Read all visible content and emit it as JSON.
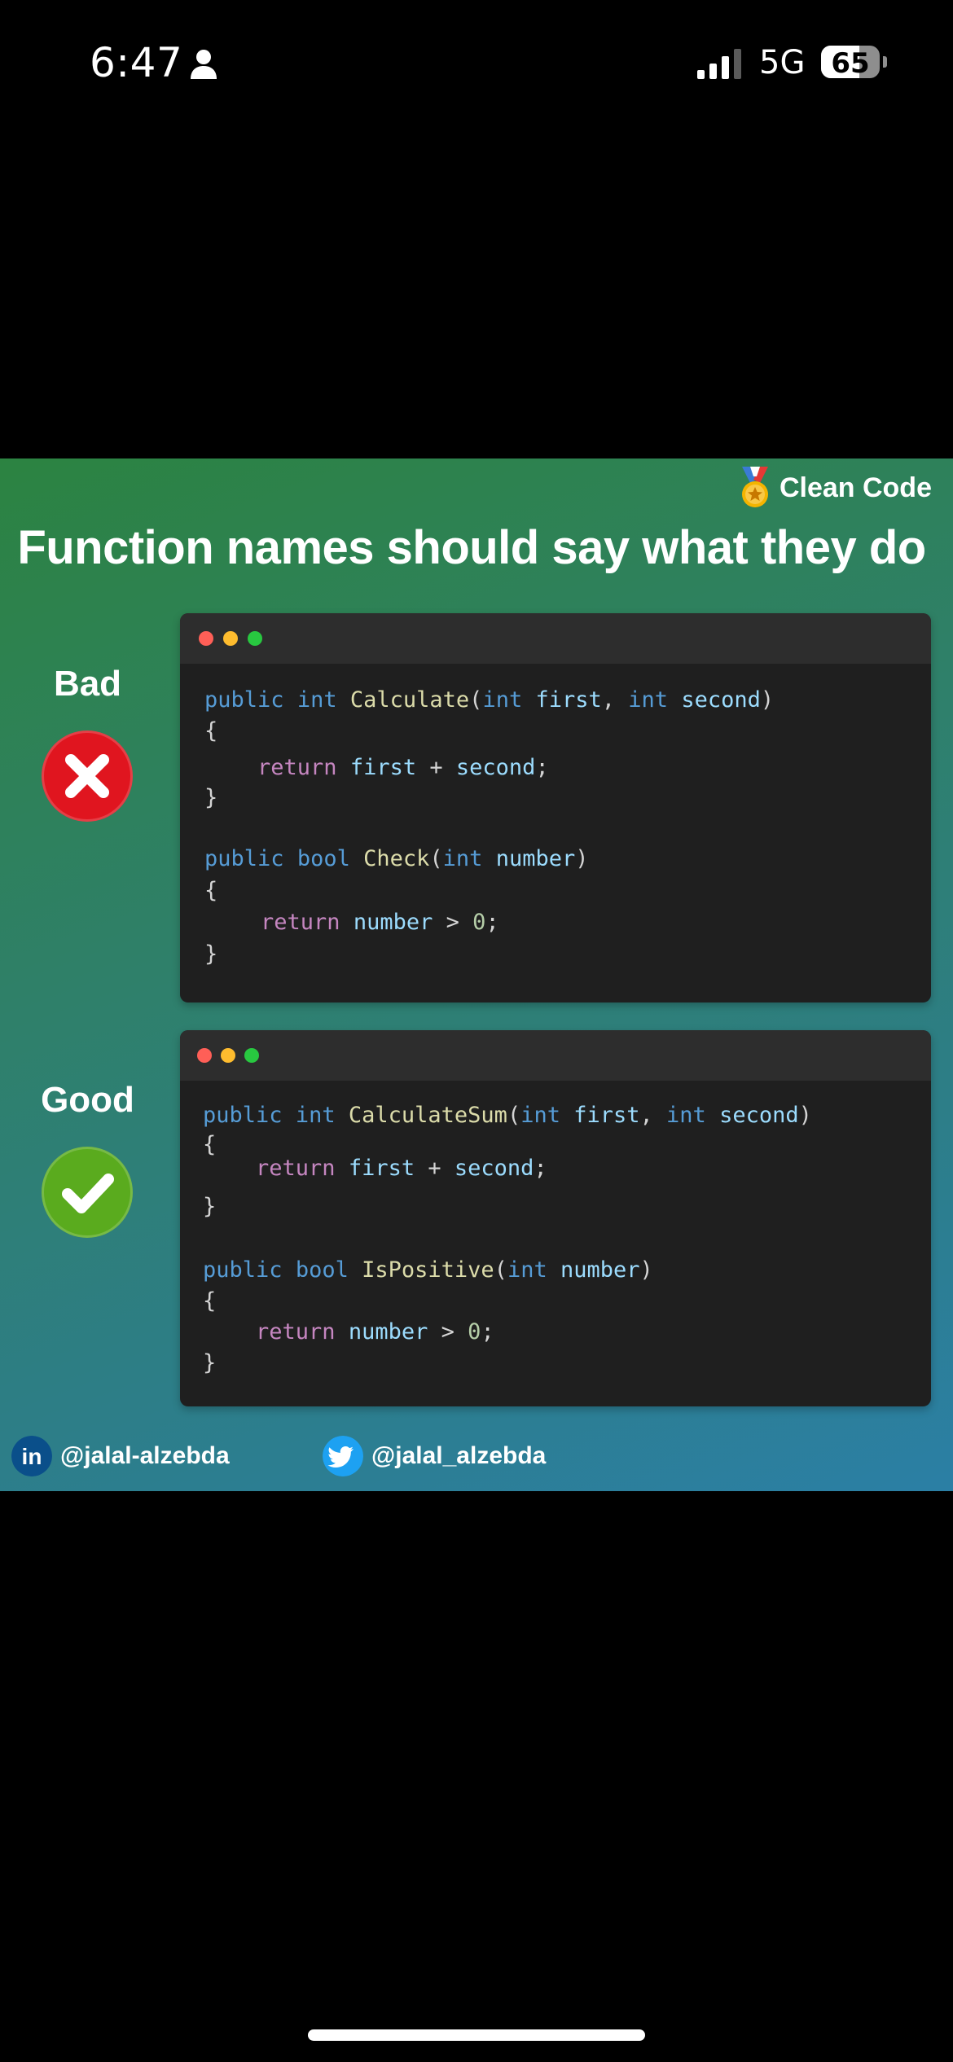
{
  "status_bar": {
    "time": "6:47",
    "network": "5G",
    "battery_percent": "65",
    "battery_level": 0.65
  },
  "post": {
    "brand": {
      "icon": "medal-icon",
      "label": "Clean Code"
    },
    "headline": "Function names should say what they do",
    "bad": {
      "label": "Bad",
      "icon": "x-icon",
      "color": "#e0151f",
      "code": {
        "l1": {
          "a": "public",
          "b": "int",
          "c": "Calculate",
          "d": "(",
          "e": "int",
          "f": "first",
          "g": ", ",
          "h": "int",
          "i": "second",
          "j": ")"
        },
        "l2": "{",
        "l3": {
          "a": "return",
          "b": "first",
          "c": " + ",
          "d": "second",
          "e": ";"
        },
        "l4": "}",
        "l5": {
          "a": "public",
          "b": "bool",
          "c": "Check",
          "d": "(",
          "e": "int",
          "f": "number",
          "g": ")"
        },
        "l6": "{",
        "l7": {
          "a": "return",
          "b": "number",
          "c": " > ",
          "d": "0",
          "e": ";"
        },
        "l8": "}"
      }
    },
    "good": {
      "label": "Good",
      "icon": "check-icon",
      "color": "#5aab1e",
      "code": {
        "l1": {
          "a": "public",
          "b": "int",
          "c": "CalculateSum",
          "d": "(",
          "e": "int",
          "f": "first",
          "g": ", ",
          "h": "int",
          "i": "second",
          "j": ")"
        },
        "l2": "{",
        "l3": {
          "a": "return",
          "b": "first",
          "c": " + ",
          "d": "second",
          "e": ";"
        },
        "l4": "}",
        "l5": {
          "a": "public",
          "b": "bool",
          "c": "IsPositive",
          "d": "(",
          "e": "int",
          "f": "number",
          "g": ")"
        },
        "l6": "{",
        "l7": {
          "a": "return",
          "b": "number",
          "c": " > ",
          "d": "0",
          "e": ";"
        },
        "l8": "}"
      }
    },
    "window_dots": {
      "red": "#ff5f57",
      "yellow": "#febc2e",
      "green": "#28c840"
    },
    "footer": {
      "linkedin": {
        "icon": "linkedin-icon",
        "handle": "@jalal-alzebda"
      },
      "twitter": {
        "icon": "twitter-icon",
        "handle": "@jalal_alzebda"
      }
    }
  }
}
